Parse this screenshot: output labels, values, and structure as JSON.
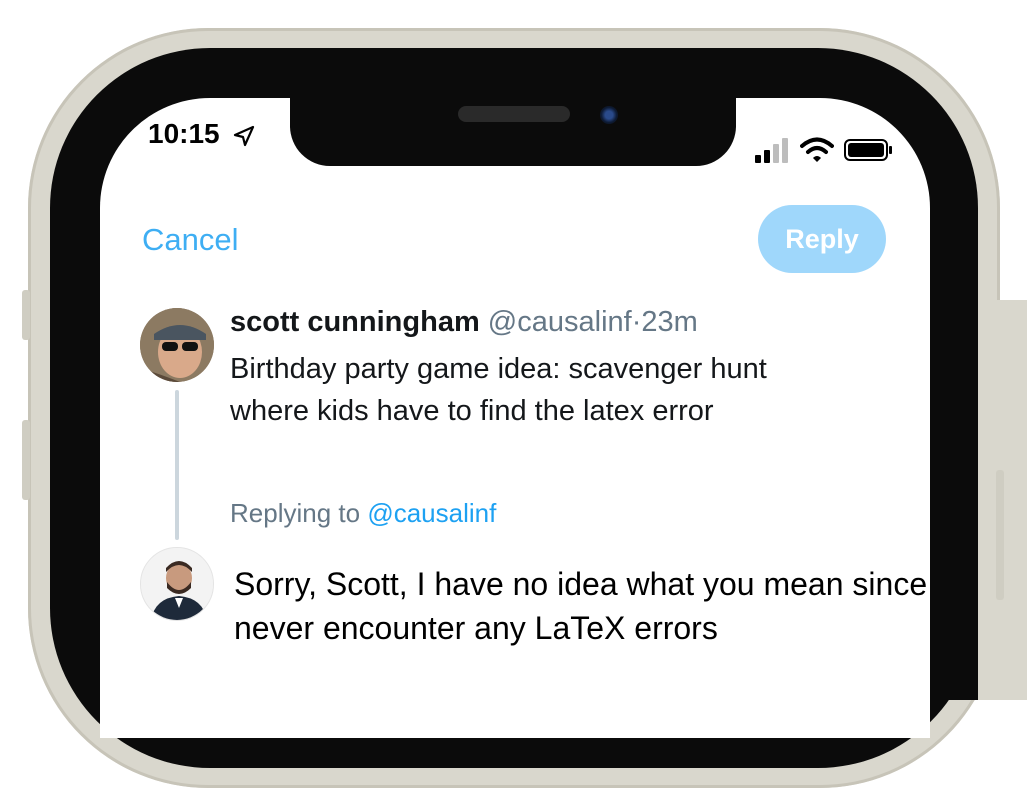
{
  "status_bar": {
    "time": "10:15"
  },
  "nav": {
    "cancel_label": "Cancel",
    "reply_label": "Reply"
  },
  "original_tweet": {
    "author_name": "scott cunningham",
    "author_handle": "@causalinf",
    "separator": "·",
    "time_ago": "23m",
    "text_line1": "Birthday party game idea: scavenger hunt",
    "text_line2": "where kids have to find the latex error"
  },
  "reply": {
    "replying_prefix": "Replying to",
    "replying_to": "@causalinf",
    "text_line1": "Sorry, Scott, I have no idea what you mean since I",
    "text_line2": "never encounter any LaTeX errors"
  },
  "icons": [
    "location-arrow-icon",
    "signal-icon",
    "wifi-icon",
    "battery-icon"
  ],
  "colors": {
    "accent": "#1da1f2",
    "reply_button_disabled": "#9fd7fb",
    "secondary_text": "#657786"
  }
}
